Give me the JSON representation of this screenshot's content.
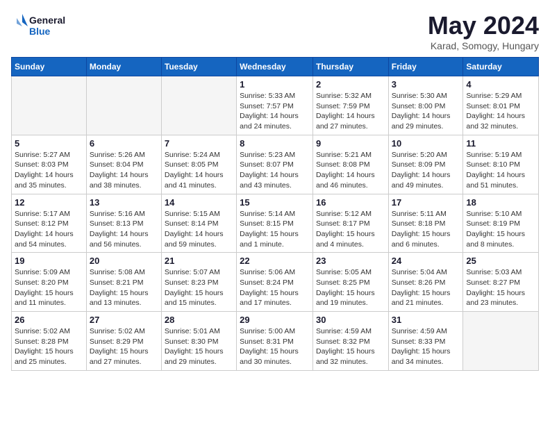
{
  "header": {
    "logo_line1": "General",
    "logo_line2": "Blue",
    "month_year": "May 2024",
    "location": "Karad, Somogy, Hungary"
  },
  "weekdays": [
    "Sunday",
    "Monday",
    "Tuesday",
    "Wednesday",
    "Thursday",
    "Friday",
    "Saturday"
  ],
  "weeks": [
    [
      {
        "day": "",
        "info": ""
      },
      {
        "day": "",
        "info": ""
      },
      {
        "day": "",
        "info": ""
      },
      {
        "day": "1",
        "info": "Sunrise: 5:33 AM\nSunset: 7:57 PM\nDaylight: 14 hours\nand 24 minutes."
      },
      {
        "day": "2",
        "info": "Sunrise: 5:32 AM\nSunset: 7:59 PM\nDaylight: 14 hours\nand 27 minutes."
      },
      {
        "day": "3",
        "info": "Sunrise: 5:30 AM\nSunset: 8:00 PM\nDaylight: 14 hours\nand 29 minutes."
      },
      {
        "day": "4",
        "info": "Sunrise: 5:29 AM\nSunset: 8:01 PM\nDaylight: 14 hours\nand 32 minutes."
      }
    ],
    [
      {
        "day": "5",
        "info": "Sunrise: 5:27 AM\nSunset: 8:03 PM\nDaylight: 14 hours\nand 35 minutes."
      },
      {
        "day": "6",
        "info": "Sunrise: 5:26 AM\nSunset: 8:04 PM\nDaylight: 14 hours\nand 38 minutes."
      },
      {
        "day": "7",
        "info": "Sunrise: 5:24 AM\nSunset: 8:05 PM\nDaylight: 14 hours\nand 41 minutes."
      },
      {
        "day": "8",
        "info": "Sunrise: 5:23 AM\nSunset: 8:07 PM\nDaylight: 14 hours\nand 43 minutes."
      },
      {
        "day": "9",
        "info": "Sunrise: 5:21 AM\nSunset: 8:08 PM\nDaylight: 14 hours\nand 46 minutes."
      },
      {
        "day": "10",
        "info": "Sunrise: 5:20 AM\nSunset: 8:09 PM\nDaylight: 14 hours\nand 49 minutes."
      },
      {
        "day": "11",
        "info": "Sunrise: 5:19 AM\nSunset: 8:10 PM\nDaylight: 14 hours\nand 51 minutes."
      }
    ],
    [
      {
        "day": "12",
        "info": "Sunrise: 5:17 AM\nSunset: 8:12 PM\nDaylight: 14 hours\nand 54 minutes."
      },
      {
        "day": "13",
        "info": "Sunrise: 5:16 AM\nSunset: 8:13 PM\nDaylight: 14 hours\nand 56 minutes."
      },
      {
        "day": "14",
        "info": "Sunrise: 5:15 AM\nSunset: 8:14 PM\nDaylight: 14 hours\nand 59 minutes."
      },
      {
        "day": "15",
        "info": "Sunrise: 5:14 AM\nSunset: 8:15 PM\nDaylight: 15 hours\nand 1 minute."
      },
      {
        "day": "16",
        "info": "Sunrise: 5:12 AM\nSunset: 8:17 PM\nDaylight: 15 hours\nand 4 minutes."
      },
      {
        "day": "17",
        "info": "Sunrise: 5:11 AM\nSunset: 8:18 PM\nDaylight: 15 hours\nand 6 minutes."
      },
      {
        "day": "18",
        "info": "Sunrise: 5:10 AM\nSunset: 8:19 PM\nDaylight: 15 hours\nand 8 minutes."
      }
    ],
    [
      {
        "day": "19",
        "info": "Sunrise: 5:09 AM\nSunset: 8:20 PM\nDaylight: 15 hours\nand 11 minutes."
      },
      {
        "day": "20",
        "info": "Sunrise: 5:08 AM\nSunset: 8:21 PM\nDaylight: 15 hours\nand 13 minutes."
      },
      {
        "day": "21",
        "info": "Sunrise: 5:07 AM\nSunset: 8:23 PM\nDaylight: 15 hours\nand 15 minutes."
      },
      {
        "day": "22",
        "info": "Sunrise: 5:06 AM\nSunset: 8:24 PM\nDaylight: 15 hours\nand 17 minutes."
      },
      {
        "day": "23",
        "info": "Sunrise: 5:05 AM\nSunset: 8:25 PM\nDaylight: 15 hours\nand 19 minutes."
      },
      {
        "day": "24",
        "info": "Sunrise: 5:04 AM\nSunset: 8:26 PM\nDaylight: 15 hours\nand 21 minutes."
      },
      {
        "day": "25",
        "info": "Sunrise: 5:03 AM\nSunset: 8:27 PM\nDaylight: 15 hours\nand 23 minutes."
      }
    ],
    [
      {
        "day": "26",
        "info": "Sunrise: 5:02 AM\nSunset: 8:28 PM\nDaylight: 15 hours\nand 25 minutes."
      },
      {
        "day": "27",
        "info": "Sunrise: 5:02 AM\nSunset: 8:29 PM\nDaylight: 15 hours\nand 27 minutes."
      },
      {
        "day": "28",
        "info": "Sunrise: 5:01 AM\nSunset: 8:30 PM\nDaylight: 15 hours\nand 29 minutes."
      },
      {
        "day": "29",
        "info": "Sunrise: 5:00 AM\nSunset: 8:31 PM\nDaylight: 15 hours\nand 30 minutes."
      },
      {
        "day": "30",
        "info": "Sunrise: 4:59 AM\nSunset: 8:32 PM\nDaylight: 15 hours\nand 32 minutes."
      },
      {
        "day": "31",
        "info": "Sunrise: 4:59 AM\nSunset: 8:33 PM\nDaylight: 15 hours\nand 34 minutes."
      },
      {
        "day": "",
        "info": ""
      }
    ]
  ]
}
